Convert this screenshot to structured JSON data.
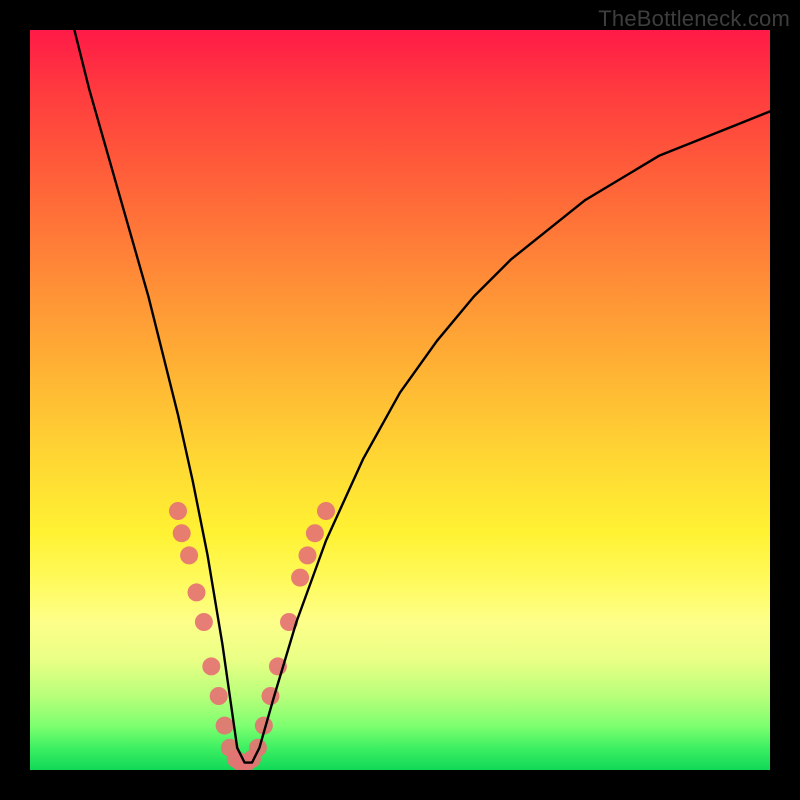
{
  "watermark": "TheBottleneck.com",
  "chart_data": {
    "type": "line",
    "title": "",
    "xlabel": "",
    "ylabel": "",
    "xlim": [
      0,
      100
    ],
    "ylim": [
      0,
      100
    ],
    "background": "rainbow-vertical-gradient",
    "curve_description": "V-shaped bottleneck curve with minimum near x≈28, left arm steeper than right",
    "series": [
      {
        "name": "bottleneck-curve",
        "color": "#000000",
        "x": [
          6,
          8,
          10,
          12,
          14,
          16,
          18,
          20,
          22,
          24,
          26,
          27,
          28,
          29,
          30,
          31,
          33,
          36,
          40,
          45,
          50,
          55,
          60,
          65,
          70,
          75,
          80,
          85,
          90,
          95,
          100
        ],
        "y": [
          100,
          92,
          85,
          78,
          71,
          64,
          56,
          48,
          39,
          29,
          17,
          10,
          3,
          1,
          1,
          3,
          10,
          20,
          31,
          42,
          51,
          58,
          64,
          69,
          73,
          77,
          80,
          83,
          85,
          87,
          89
        ]
      }
    ],
    "markers": {
      "name": "highlight-dots",
      "color": "#e57373",
      "points": [
        {
          "x": 20.0,
          "y": 35
        },
        {
          "x": 20.5,
          "y": 32
        },
        {
          "x": 21.5,
          "y": 29
        },
        {
          "x": 22.5,
          "y": 24
        },
        {
          "x": 23.5,
          "y": 20
        },
        {
          "x": 24.5,
          "y": 14
        },
        {
          "x": 25.5,
          "y": 10
        },
        {
          "x": 26.3,
          "y": 6
        },
        {
          "x": 27.0,
          "y": 3
        },
        {
          "x": 27.8,
          "y": 1.5
        },
        {
          "x": 28.5,
          "y": 1
        },
        {
          "x": 29.3,
          "y": 1
        },
        {
          "x": 30.0,
          "y": 1.5
        },
        {
          "x": 30.8,
          "y": 3
        },
        {
          "x": 31.6,
          "y": 6
        },
        {
          "x": 32.5,
          "y": 10
        },
        {
          "x": 33.5,
          "y": 14
        },
        {
          "x": 35.0,
          "y": 20
        },
        {
          "x": 36.5,
          "y": 26
        },
        {
          "x": 37.5,
          "y": 29
        },
        {
          "x": 38.5,
          "y": 32
        },
        {
          "x": 40.0,
          "y": 35
        }
      ]
    }
  }
}
